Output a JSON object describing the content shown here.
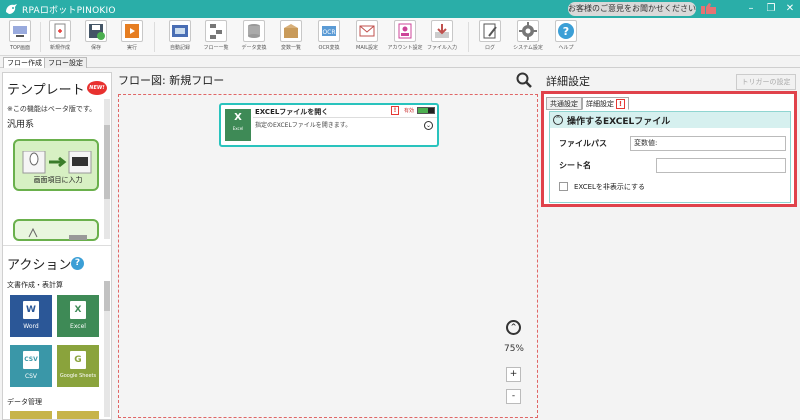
{
  "app": {
    "title": "RPAロボットPINOKIO",
    "feedback": "お客様のご意見をお聞かせください",
    "window": {
      "minimize": "–",
      "restore": "❐",
      "close": "✕"
    }
  },
  "toolbar": [
    {
      "name": "top-screen",
      "label": "TOP画面"
    },
    {
      "name": "new-create",
      "label": "新規作成"
    },
    {
      "name": "save",
      "label": "保存"
    },
    {
      "name": "run",
      "label": "実行"
    },
    {
      "name": "auto-record",
      "label": "自動記録"
    },
    {
      "name": "flow-list",
      "label": "フロー一覧"
    },
    {
      "name": "data-transform",
      "label": "データ変換"
    },
    {
      "name": "variable-list",
      "label": "変数一覧"
    },
    {
      "name": "ocr-transform",
      "label": "OCR変換"
    },
    {
      "name": "mail-settings",
      "label": "MAIL設定"
    },
    {
      "name": "account-settings",
      "label": "アカウント設定"
    },
    {
      "name": "file-input",
      "label": "ファイル入力"
    },
    {
      "name": "log",
      "label": "ログ"
    },
    {
      "name": "system-settings",
      "label": "システム設定"
    },
    {
      "name": "help",
      "label": "ヘルプ"
    }
  ],
  "menu_tabs": [
    "フロー作成",
    "フロー設定"
  ],
  "left": {
    "template_title": "テンプレート",
    "new_badge": "NEW!",
    "beta_note": "※この機能はベータ版です。",
    "group_general": "汎用系",
    "template_card_label": "画面項目に入力",
    "mini_left": "マウス操作",
    "mini_right": "キー操作",
    "action_title": "アクション",
    "action_help": "?",
    "category_docs": "文書作成・表計算",
    "tiles": [
      {
        "name": "word",
        "label": "Word",
        "glyph": "W",
        "color": "#2b5797"
      },
      {
        "name": "excel",
        "label": "Excel",
        "glyph": "X",
        "color": "#3e8a56"
      },
      {
        "name": "csv",
        "label": "CSV",
        "glyph": "CSV",
        "color": "#3a97a8"
      },
      {
        "name": "google-sheets",
        "label": "Google Sheets",
        "glyph": "G",
        "color": "#8aa33c"
      }
    ],
    "category_data": "データ管理"
  },
  "flow": {
    "title": "フロー図:  新規フロー",
    "node": {
      "icon_glyph": "X",
      "icon_text": "Excel",
      "title": "EXCELファイルを開く",
      "warn": "!",
      "valid_label": "有効",
      "description": "指定のEXCELファイルを開きます。",
      "expand": "⌄"
    },
    "zoom": "75%",
    "zoom_up": "^",
    "zoom_in": "+",
    "zoom_out": "-"
  },
  "right": {
    "title": "詳細設定",
    "trigger_button": "トリガーの設定",
    "tabs": [
      "共通設定",
      "詳細設定"
    ],
    "tab_warn": "!",
    "section_title": "操作するEXCELファイル",
    "section_chev": "^",
    "file_path_label": "ファイルパス",
    "file_path_value": "変数値:",
    "sheet_label": "シート名",
    "sheet_value": "",
    "hide_excel_label": "EXCELを非表示にする"
  },
  "colors": {
    "titlebar": "#2aaea8",
    "highlight": "#e0424b",
    "node_border": "#29c3bd"
  }
}
